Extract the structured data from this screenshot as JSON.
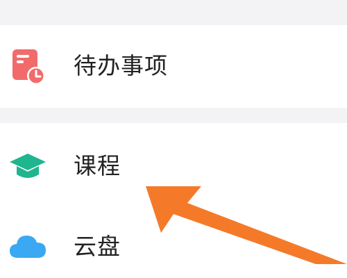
{
  "menu": {
    "items": [
      {
        "label": "待办事项",
        "icon": "todo-clock-icon",
        "icon_color": "#f26b6b"
      },
      {
        "label": "课程",
        "icon": "graduation-cap-icon",
        "icon_color": "#1fb58e"
      },
      {
        "label": "云盘",
        "icon": "cloud-icon",
        "icon_color": "#3aa8f2"
      }
    ]
  },
  "colors": {
    "background": "#ffffff",
    "section_gap": "#f3f3f5",
    "annotation_arrow": "#f47a2a"
  }
}
